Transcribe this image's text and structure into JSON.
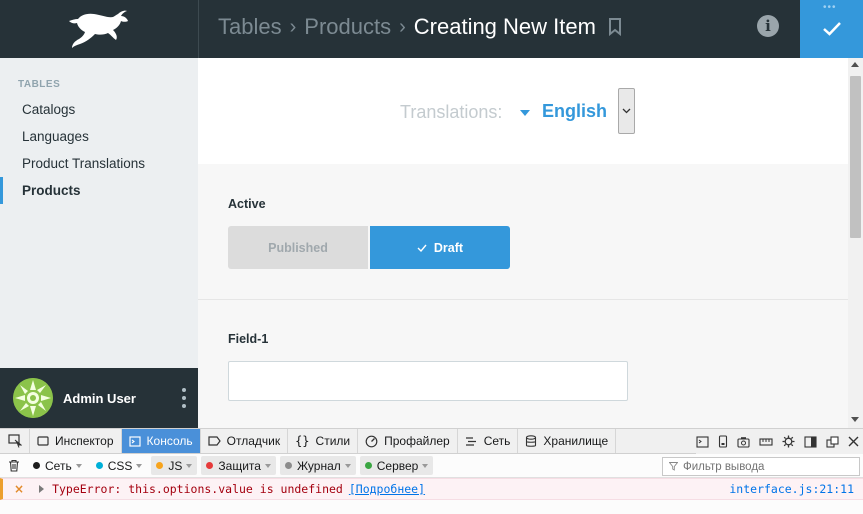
{
  "header": {
    "breadcrumb": [
      "Tables",
      "Products",
      "Creating New Item"
    ],
    "icons": {
      "logo": "rabbit-logo",
      "bookmark": "bookmark-icon",
      "info": "info-icon",
      "save": "check-icon"
    }
  },
  "sidebar": {
    "heading": "TABLES",
    "items": [
      {
        "label": "Catalogs",
        "active": false
      },
      {
        "label": "Languages",
        "active": false
      },
      {
        "label": "Product Translations",
        "active": false
      },
      {
        "label": "Products",
        "active": true
      }
    ],
    "user": {
      "name": "Admin User"
    }
  },
  "main": {
    "translations_label": "Translations:",
    "translations_value": "English",
    "fields": [
      {
        "label": "Active",
        "options": [
          "Published",
          "Draft"
        ],
        "selected": "Draft"
      },
      {
        "label": "Field-1",
        "value": "",
        "placeholder": ""
      }
    ]
  },
  "devtools": {
    "tabs": [
      "Инспектор",
      "Консоль",
      "Отладчик",
      "Стили",
      "Профайлер",
      "Сеть",
      "Хранилище"
    ],
    "active_tab": "Консоль",
    "filters": [
      {
        "label": "Сеть",
        "color": "#1d1d1d"
      },
      {
        "label": "CSS",
        "color": "#00b0d8"
      },
      {
        "label": "JS",
        "color": "#f7a41d"
      },
      {
        "label": "Защита",
        "color": "#e63b3b"
      },
      {
        "label": "Журнал",
        "color": "#8c8c8c"
      },
      {
        "label": "Сервер",
        "color": "#3aa642"
      }
    ],
    "filter_placeholder": "Фильтр вывода",
    "error": {
      "message": "TypeError: this.options.value is undefined",
      "more": "[Подробнее]",
      "source": "interface.js:21:11"
    }
  },
  "colors": {
    "accent": "#3498db",
    "header_bg": "#263238",
    "sidebar_bg": "#eceff1"
  }
}
